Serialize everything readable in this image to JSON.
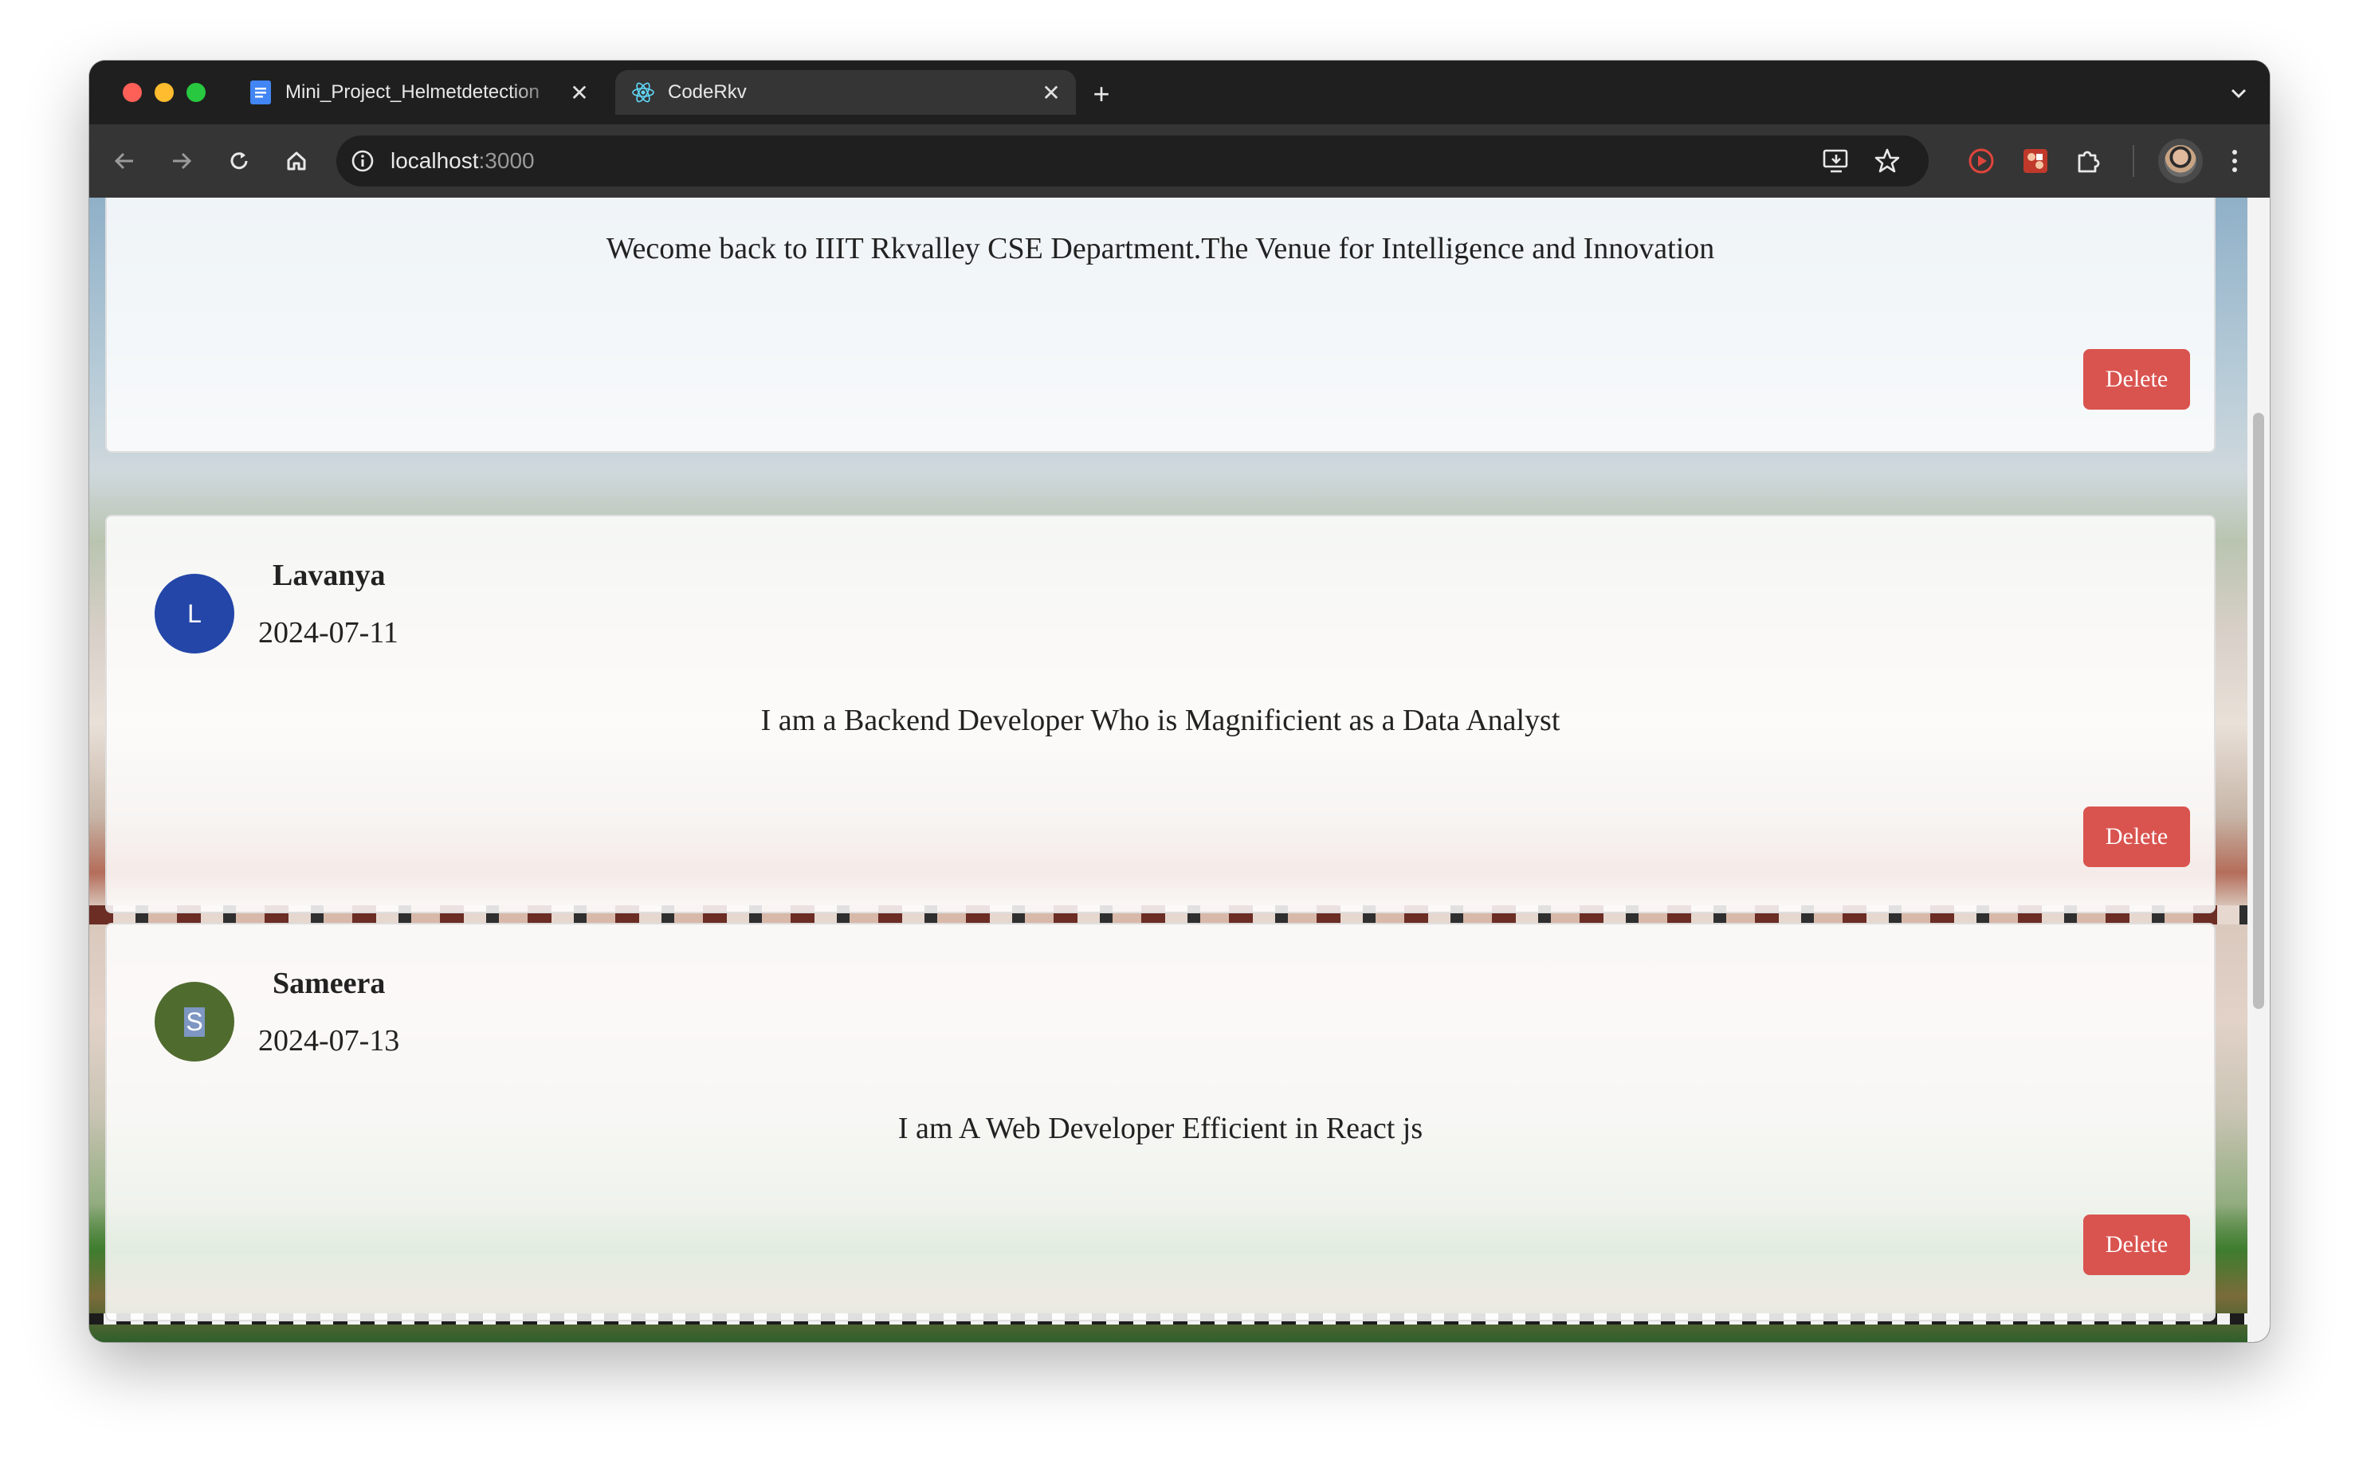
{
  "browser": {
    "tabs": [
      {
        "title": "Mini_Project_Helmetdetection",
        "icon": "google-docs-icon",
        "active": false
      },
      {
        "title": "CodeRkv",
        "icon": "react-icon",
        "active": true
      }
    ],
    "url_host": "localhost",
    "url_port": ":3000"
  },
  "posts": [
    {
      "message": "Wecome back to IIIT Rkvalley CSE Department.The Venue for Intelligence and Innovation",
      "delete_label": "Delete"
    },
    {
      "avatar_letter": "L",
      "avatar_color": "#2346a8",
      "name": "Lavanya",
      "date": "2024-07-11",
      "message": "I am a Backend Developer Who is Magnificient as a Data Analyst",
      "delete_label": "Delete"
    },
    {
      "avatar_letter": "S",
      "avatar_color": "#4f6b2e",
      "name": "Sameera",
      "date": "2024-07-13",
      "message": "I am A Web Developer Efficient in React js",
      "delete_label": "Delete"
    }
  ],
  "colors": {
    "delete_button": "#d9534f",
    "browser_frame": "#1f1f1f",
    "toolbar": "#353535"
  }
}
